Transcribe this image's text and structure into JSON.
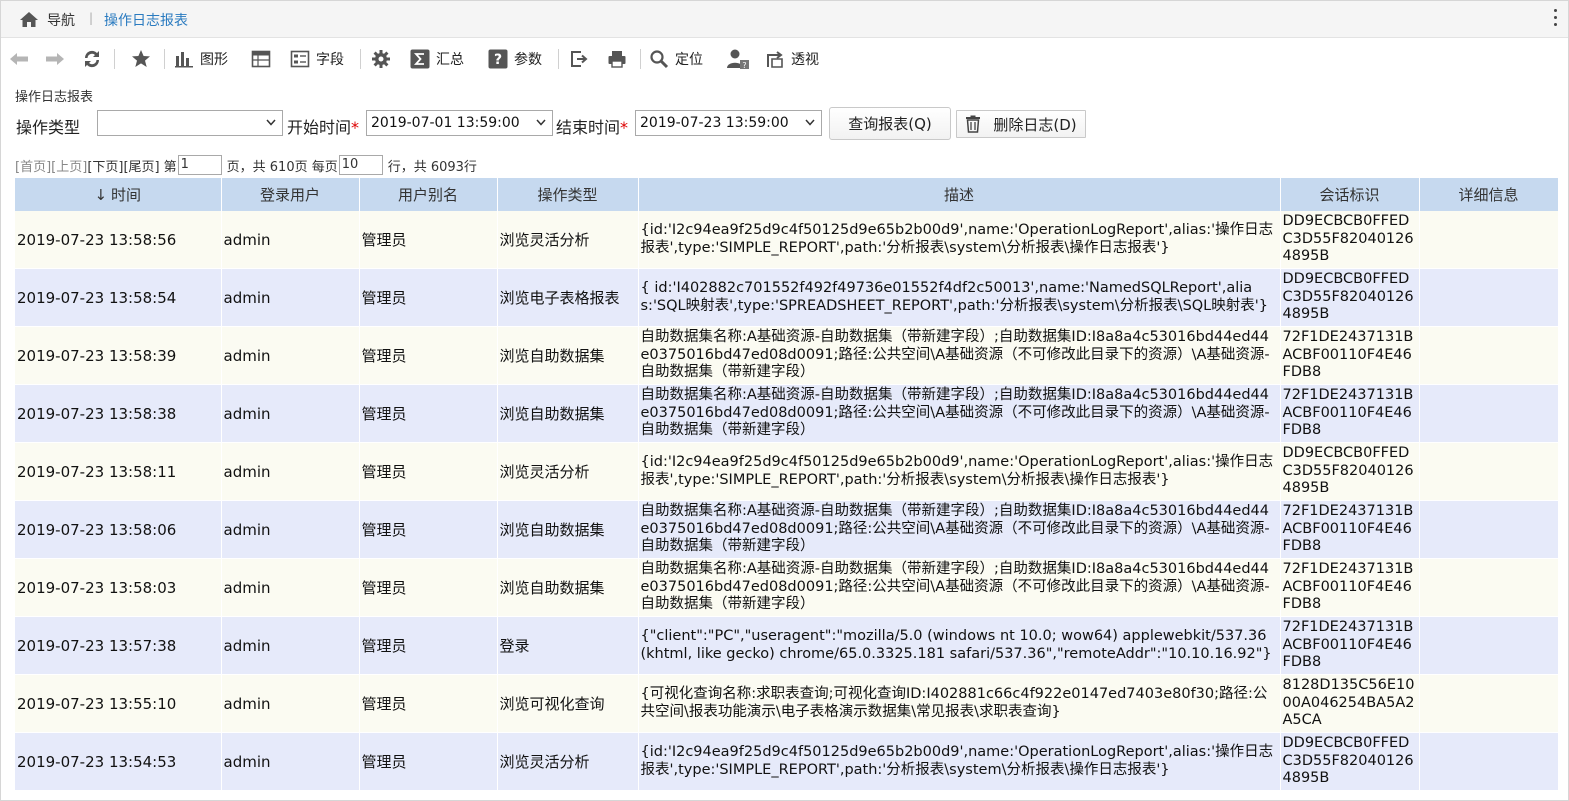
{
  "breadcrumb": {
    "nav": "导航",
    "separator": "|",
    "current": "操作日志报表"
  },
  "toolbar": {
    "chart": "图形",
    "fields": "字段",
    "summary": "汇总",
    "params": "参数",
    "locate": "定位",
    "pivot": "透视"
  },
  "report_title": "操作日志报表",
  "filters": {
    "op_type_label": "操作类型",
    "op_type_value": "",
    "start_label": "开始时间",
    "start_value": "2019-07-01 13:59:00",
    "end_label": "结束时间",
    "end_value": "2019-07-23 13:59:00",
    "required_mark": "*",
    "query_button": "查询报表(Q)",
    "delete_button": "删除日志(D)"
  },
  "pager": {
    "first": "[首页]",
    "prev": "[上页]",
    "next": "[下页]",
    "last": "[尾页]",
    "page_prefix": "第",
    "page_value": "1",
    "page_suffix": "页，共 610页 每页",
    "per_page_value": "10",
    "total_suffix": "行，共 6093行"
  },
  "table": {
    "columns": [
      "时间",
      "登录用户",
      "用户别名",
      "操作类型",
      "描述",
      "会话标识",
      "详细信息"
    ],
    "rows": [
      {
        "time": "2019-07-23  13:58:56",
        "user": "admin",
        "alias": "管理员",
        "type": "浏览灵活分析",
        "desc": "{id:'I2c94ea9f25d9c4f50125d9e65b2b00d9',name:'OperationLogReport',alias:'操作日志报表',type:'SIMPLE_REPORT',path:'分析报表\\system\\分析报表\\操作日志报表'}",
        "session": "DD9ECBCB0FFEDC3D55F820401264895B",
        "detail": ""
      },
      {
        "time": "2019-07-23  13:58:54",
        "user": "admin",
        "alias": "管理员",
        "type": "浏览电子表格报表",
        "desc": "{ id:'I402882c701552f492f49736e01552f4df2c50013',name:'NamedSQLReport',alias:'SQL映射表',type:'SPREADSHEET_REPORT',path:'分析报表\\system\\分析报表\\SQL映射表'}",
        "session": "DD9ECBCB0FFEDC3D55F820401264895B",
        "detail": ""
      },
      {
        "time": "2019-07-23  13:58:39",
        "user": "admin",
        "alias": "管理员",
        "type": "浏览自助数据集",
        "desc": "自助数据集名称:A基础资源-自助数据集（带新建字段）;自助数据集ID:I8a8a4c53016bd44ed44e0375016bd47ed08d0091;路径:公共空间\\A基础资源（不可修改此目录下的资源）\\A基础资源-自助数据集（带新建字段）",
        "session": "72F1DE2437131BACBF00110F4E46FDB8",
        "detail": ""
      },
      {
        "time": "2019-07-23  13:58:38",
        "user": "admin",
        "alias": "管理员",
        "type": "浏览自助数据集",
        "desc": "自助数据集名称:A基础资源-自助数据集（带新建字段）;自助数据集ID:I8a8a4c53016bd44ed44e0375016bd47ed08d0091;路径:公共空间\\A基础资源（不可修改此目录下的资源）\\A基础资源-自助数据集（带新建字段）",
        "session": "72F1DE2437131BACBF00110F4E46FDB8",
        "detail": ""
      },
      {
        "time": "2019-07-23  13:58:11",
        "user": "admin",
        "alias": "管理员",
        "type": "浏览灵活分析",
        "desc": "{id:'I2c94ea9f25d9c4f50125d9e65b2b00d9',name:'OperationLogReport',alias:'操作日志报表',type:'SIMPLE_REPORT',path:'分析报表\\system\\分析报表\\操作日志报表'}",
        "session": "DD9ECBCB0FFEDC3D55F820401264895B",
        "detail": ""
      },
      {
        "time": "2019-07-23  13:58:06",
        "user": "admin",
        "alias": "管理员",
        "type": "浏览自助数据集",
        "desc": "自助数据集名称:A基础资源-自助数据集（带新建字段）;自助数据集ID:I8a8a4c53016bd44ed44e0375016bd47ed08d0091;路径:公共空间\\A基础资源（不可修改此目录下的资源）\\A基础资源-自助数据集（带新建字段）",
        "session": "72F1DE2437131BACBF00110F4E46FDB8",
        "detail": ""
      },
      {
        "time": "2019-07-23  13:58:03",
        "user": "admin",
        "alias": "管理员",
        "type": "浏览自助数据集",
        "desc": "自助数据集名称:A基础资源-自助数据集（带新建字段）;自助数据集ID:I8a8a4c53016bd44ed44e0375016bd47ed08d0091;路径:公共空间\\A基础资源（不可修改此目录下的资源）\\A基础资源-自助数据集（带新建字段）",
        "session": "72F1DE2437131BACBF00110F4E46FDB8",
        "detail": ""
      },
      {
        "time": "2019-07-23  13:57:38",
        "user": "admin",
        "alias": "管理员",
        "type": "登录",
        "desc": "{\"client\":\"PC\",\"useragent\":\"mozilla/5.0 (windows nt 10.0; wow64) applewebkit/537.36 (khtml, like gecko) chrome/65.0.3325.181 safari/537.36\",\"remoteAddr\":\"10.10.16.92\"}",
        "session": "72F1DE2437131BACBF00110F4E46FDB8",
        "detail": ""
      },
      {
        "time": "2019-07-23  13:55:10",
        "user": "admin",
        "alias": "管理员",
        "type": "浏览可视化查询",
        "desc": "{可视化查询名称:求职表查询;可视化查询ID:I402881c66c4f922e0147ed7403e80f30;路径:公共空间\\报表功能演示\\电子表格演示数据集\\常见报表\\求职表查询}",
        "session": "8128D135C56E1000A046254BA5A2A5CA",
        "detail": ""
      },
      {
        "time": "2019-07-23  13:54:53",
        "user": "admin",
        "alias": "管理员",
        "type": "浏览灵活分析",
        "desc": "{id:'I2c94ea9f25d9c4f50125d9e65b2b00d9',name:'OperationLogReport',alias:'操作日志报表',type:'SIMPLE_REPORT',path:'分析报表\\system\\分析报表\\操作日志报表'}",
        "session": "DD9ECBCB0FFEDC3D55F820401264895B",
        "detail": ""
      }
    ]
  }
}
